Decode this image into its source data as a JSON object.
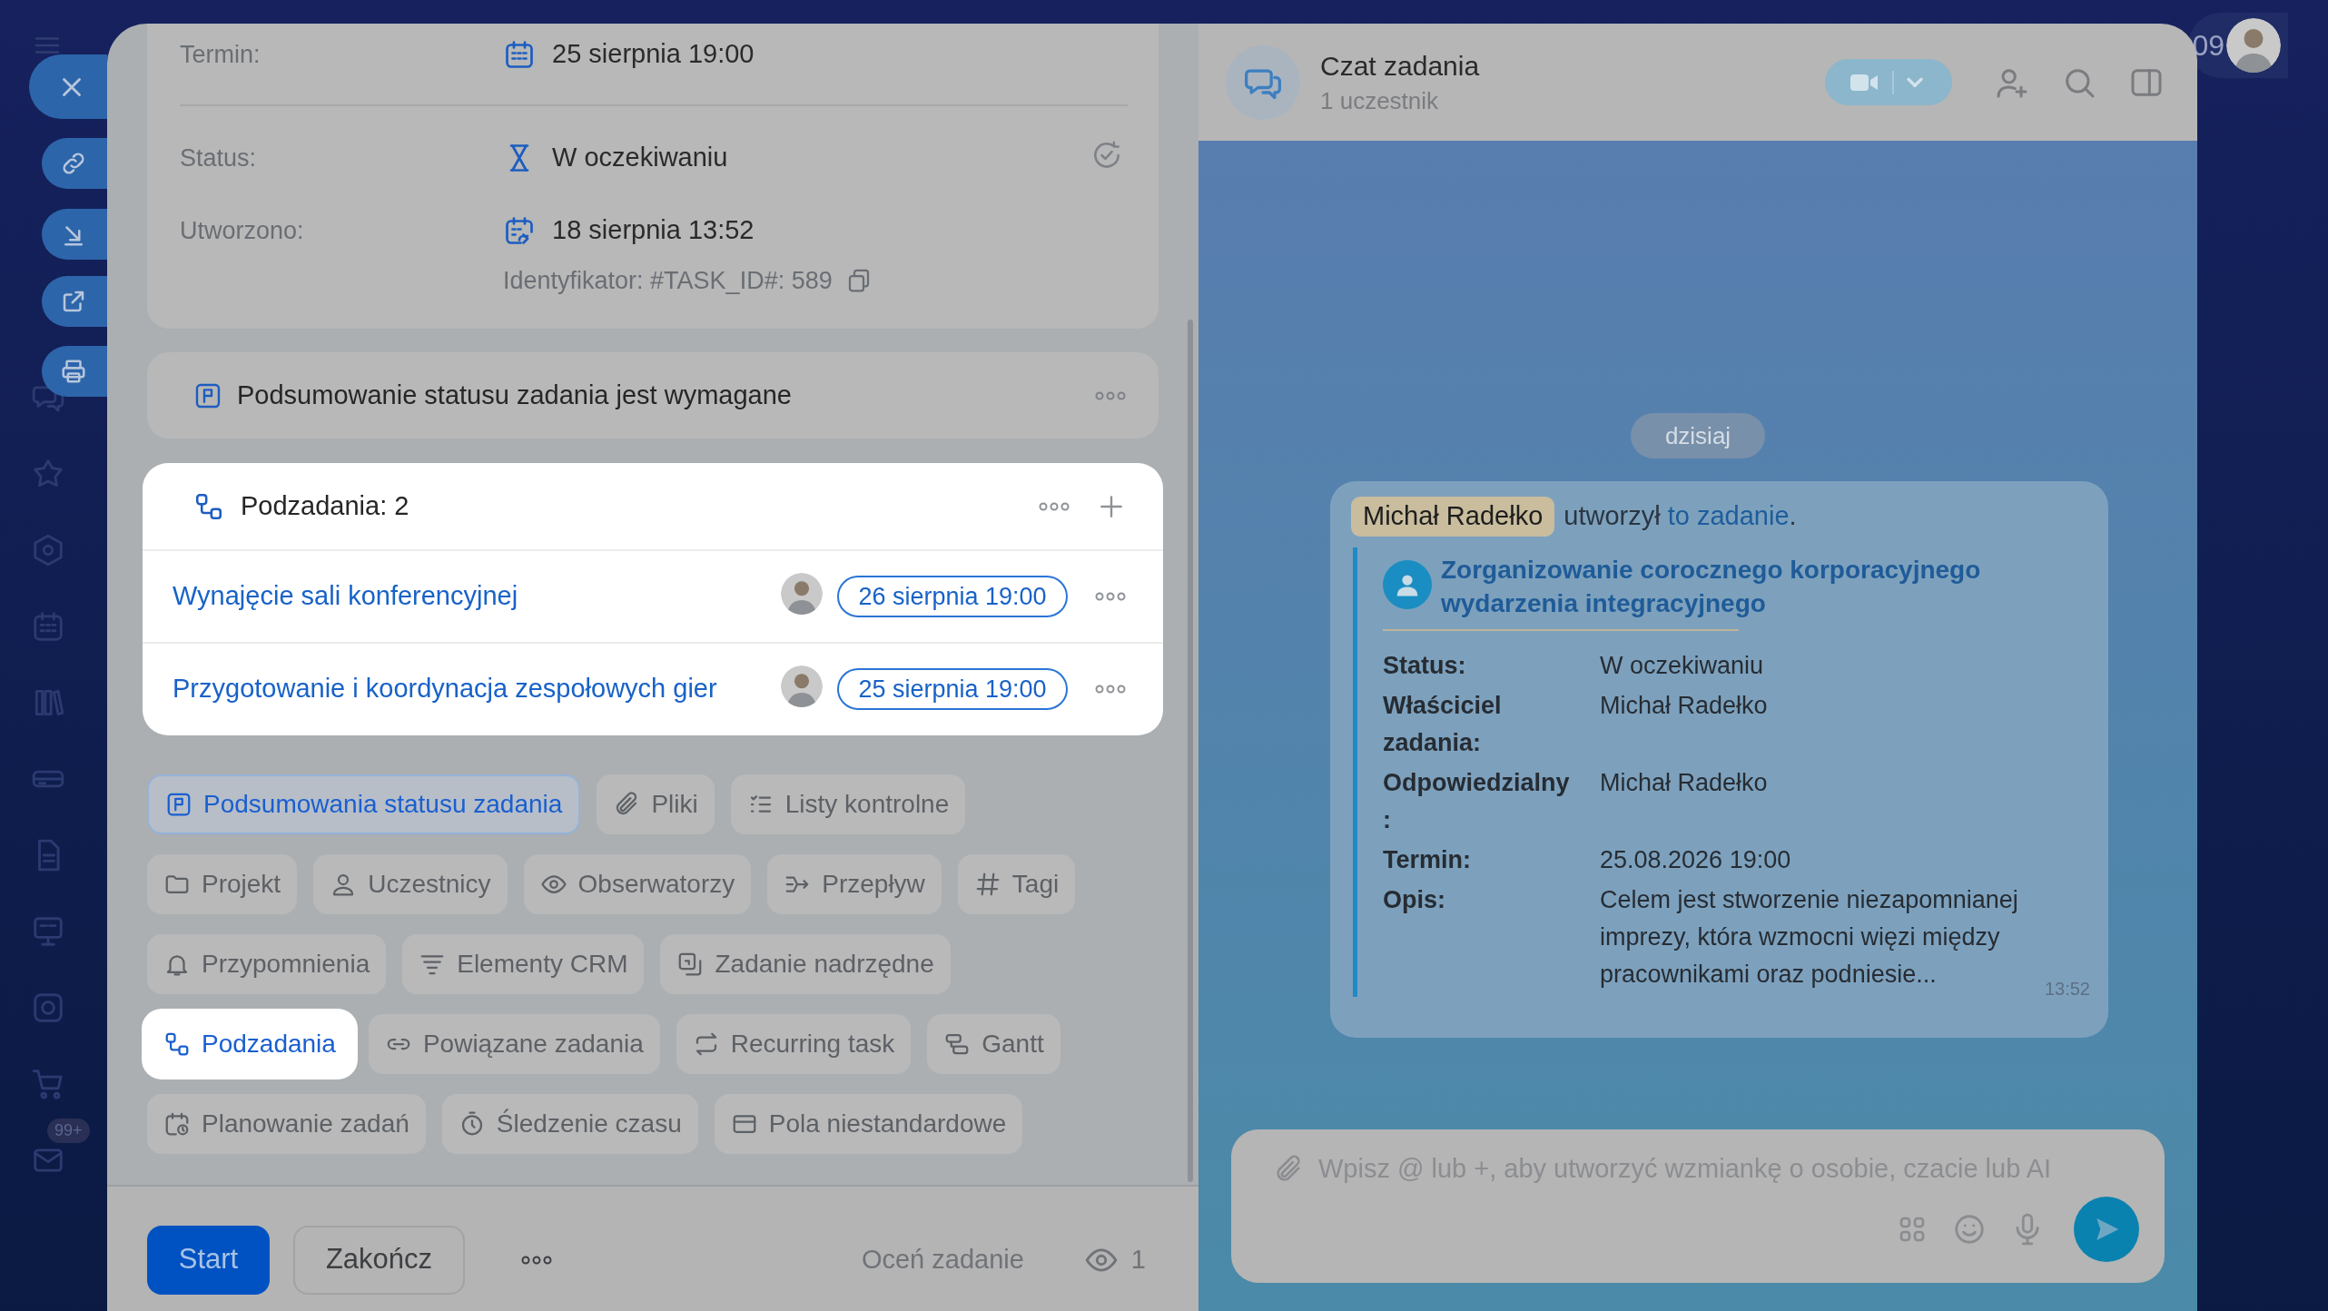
{
  "top_bar": {
    "clock": "09"
  },
  "sidebar": {
    "badge": "99+"
  },
  "quick_actions": [
    {
      "kind": "close"
    },
    {
      "kind": "link"
    },
    {
      "kind": "download"
    },
    {
      "kind": "external"
    },
    {
      "kind": "print"
    }
  ],
  "task": {
    "details": [
      {
        "kind": "deadline",
        "label": "Termin:",
        "value": "25 sierpnia 19:00"
      },
      {
        "kind": "status",
        "label": "Status:",
        "value": "W oczekiwaniu"
      },
      {
        "kind": "created",
        "label": "Utworzono:",
        "value": "18 sierpnia 13:52"
      }
    ],
    "identifier": "Identyfikator: #TASK_ID#: 589",
    "summary_notice": "Podsumowanie statusu zadania jest wymagane",
    "subtasks": {
      "title": "Podzadania: 2",
      "items": [
        {
          "title": "Wynajęcie sali konferencyjnej",
          "deadline": "26 sierpnia 19:00"
        },
        {
          "title": "Przygotowanie i koordynacja zespołowych gier",
          "deadline": "25 sierpnia 19:00"
        }
      ]
    },
    "section_rows": [
      [
        {
          "kind": "summary",
          "label": "Podsumowania statusu zadania",
          "active": true,
          "selected": false
        },
        {
          "kind": "files",
          "label": "Pliki",
          "active": false,
          "selected": false
        },
        {
          "kind": "checklist",
          "label": "Listy kontrolne",
          "active": false,
          "selected": false
        }
      ],
      [
        {
          "kind": "project",
          "label": "Projekt",
          "active": false,
          "selected": false
        },
        {
          "kind": "participants",
          "label": "Uczestnicy",
          "active": false,
          "selected": false
        },
        {
          "kind": "observers",
          "label": "Obserwatorzy",
          "active": false,
          "selected": false
        },
        {
          "kind": "flow",
          "label": "Przepływ",
          "active": false,
          "selected": false
        },
        {
          "kind": "tags",
          "label": "Tagi",
          "active": false,
          "selected": false
        }
      ],
      [
        {
          "kind": "reminders",
          "label": "Przypomnienia",
          "active": false,
          "selected": false
        },
        {
          "kind": "crm",
          "label": "Elementy CRM",
          "active": false,
          "selected": false
        },
        {
          "kind": "parent",
          "label": "Zadanie nadrzędne",
          "active": false,
          "selected": false
        }
      ],
      [
        {
          "kind": "subtasks",
          "label": "Podzadania",
          "active": true,
          "selected": true
        },
        {
          "kind": "related",
          "label": "Powiązane zadania",
          "active": false,
          "selected": false
        },
        {
          "kind": "recurring",
          "label": "Recurring task",
          "active": false,
          "selected": false
        },
        {
          "kind": "gantt",
          "label": "Gantt",
          "active": false,
          "selected": false
        }
      ],
      [
        {
          "kind": "planning",
          "label": "Planowanie zadań",
          "active": false,
          "selected": false
        },
        {
          "kind": "time",
          "label": "Śledzenie czasu",
          "active": false,
          "selected": false
        },
        {
          "kind": "fields",
          "label": "Pola niestandardowe",
          "active": false,
          "selected": false
        }
      ]
    ],
    "footer": {
      "start": "Start",
      "finish": "Zakończ",
      "rate": "Oceń zadanie",
      "viewers": "1"
    }
  },
  "chat": {
    "title": "Czat zadania",
    "subtitle": "1 uczestnik",
    "date": "dzisiaj",
    "message": {
      "author": "Michał Radełko",
      "action": "utworzył",
      "link": "to zadanie",
      "end": ".",
      "card": {
        "title": "Zorganizowanie corocznego korporacyjnego wydarzenia integracyjnego",
        "fields": [
          {
            "label": "Status:",
            "value": "W oczekiwaniu"
          },
          {
            "label": "Właściciel zadania:",
            "value": "Michał Radełko"
          },
          {
            "label": "Odpowiedzialny:",
            "value": "Michał Radełko"
          },
          {
            "label": "Termin:",
            "value": "25.08.2026 19:00"
          },
          {
            "label": "Opis:",
            "value": "Celem jest stworzenie niezapomnianej imprezy, która wzmocni więzi między pracownikami oraz podniesie..."
          }
        ]
      },
      "time": "13:52"
    },
    "input": {
      "placeholder": "Wpisz @ lub +, aby utworzyć wzmiankę o osobie, czacie lub AI"
    }
  }
}
